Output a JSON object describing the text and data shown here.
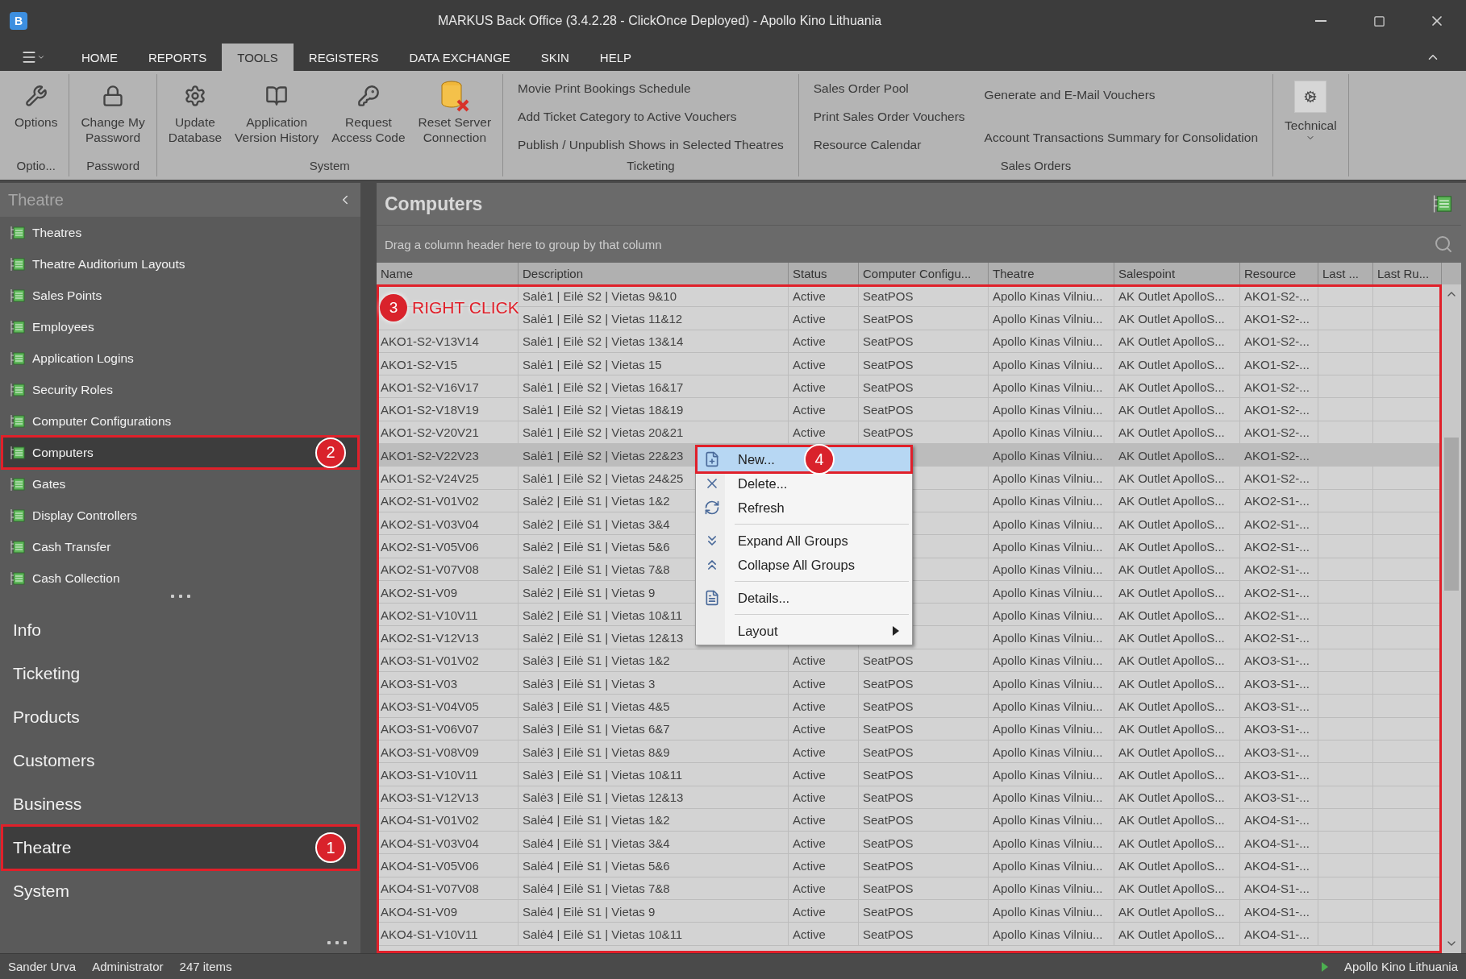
{
  "window": {
    "app_icon": "B",
    "title": "MARKUS Back Office (3.4.2.28 - ClickOnce Deployed)  - Apollo Kino Lithuania"
  },
  "ribbon": {
    "tabs": [
      {
        "label": "HOME",
        "selected": false
      },
      {
        "label": "REPORTS",
        "selected": false
      },
      {
        "label": "TOOLS",
        "selected": true
      },
      {
        "label": "REGISTERS",
        "selected": false
      },
      {
        "label": "DATA EXCHANGE",
        "selected": false
      },
      {
        "label": "SKIN",
        "selected": false
      },
      {
        "label": "HELP",
        "selected": false
      }
    ],
    "groups": [
      {
        "label": "Optio...",
        "kind": "large",
        "buttons": [
          "Options"
        ]
      },
      {
        "label": "Password",
        "kind": "large",
        "buttons": [
          "Change My\nPassword"
        ]
      },
      {
        "label": "System",
        "kind": "large",
        "buttons": [
          "Update\nDatabase",
          "Application\nVersion History",
          "Request\nAccess Code",
          "Reset Server\nConnection"
        ]
      },
      {
        "label": "Ticketing",
        "kind": "links",
        "columns": [
          [
            "Movie Print Bookings Schedule",
            "Add Ticket Category to Active Vouchers",
            "Publish / Unpublish Shows in Selected Theatres"
          ]
        ]
      },
      {
        "label": "Sales Orders",
        "kind": "links",
        "columns": [
          [
            "Sales Order Pool",
            "Print Sales Order Vouchers",
            "Resource Calendar"
          ],
          [
            "Generate and E-Mail Vouchers",
            "Account Transactions Summary for Consolidation"
          ]
        ]
      },
      {
        "kind": "dropdown",
        "buttons": [
          "Technical"
        ]
      }
    ]
  },
  "sidebar": {
    "header": "Theatre",
    "items": [
      {
        "label": "Theatres",
        "selected": false
      },
      {
        "label": "Theatre Auditorium Layouts",
        "selected": false
      },
      {
        "label": "Sales Points",
        "selected": false
      },
      {
        "label": "Employees",
        "selected": false
      },
      {
        "label": "Application Logins",
        "selected": false
      },
      {
        "label": "Security Roles",
        "selected": false
      },
      {
        "label": "Computer Configurations",
        "selected": false
      },
      {
        "label": "Computers",
        "selected": true,
        "annotation": "2"
      },
      {
        "label": "Gates",
        "selected": false
      },
      {
        "label": "Display Controllers",
        "selected": false
      },
      {
        "label": "Cash Transfer",
        "selected": false
      },
      {
        "label": "Cash Collection",
        "selected": false
      }
    ],
    "groups": [
      {
        "label": "Info",
        "selected": false
      },
      {
        "label": "Ticketing",
        "selected": false
      },
      {
        "label": "Products",
        "selected": false
      },
      {
        "label": "Customers",
        "selected": false
      },
      {
        "label": "Business",
        "selected": false
      },
      {
        "label": "Theatre",
        "selected": true,
        "annotation": "1"
      },
      {
        "label": "System",
        "selected": false
      }
    ]
  },
  "main": {
    "title": "Computers",
    "group_panel": "Drag a column header here to group by that column",
    "table": {
      "columns": [
        "Name",
        "Description",
        "Status",
        "Computer Configu...",
        "Theatre",
        "Salespoint",
        "Resource",
        "Last ...",
        "Last Ru..."
      ],
      "annotation": {
        "number": "3",
        "text": "RIGHT CLICK"
      },
      "rows": [
        {
          "description": "Salė1 | Eilė S2 | Vietas 9&10",
          "status": "Active",
          "configuration": "SeatPOS",
          "theatre": "Apollo Kinas Vilniu...",
          "salespoint": "AK Outlet ApolloS...",
          "resource": "AKO1-S2-...",
          "selected": false
        },
        {
          "description": "Salė1 | Eilė S2 | Vietas 11&12",
          "status": "Active",
          "configuration": "SeatPOS",
          "theatre": "Apollo Kinas Vilniu...",
          "salespoint": "AK Outlet ApolloS...",
          "resource": "AKO1-S2-...",
          "selected": false
        },
        {
          "name": "AKO1-S2-V13V14",
          "description": "Salė1 | Eilė S2 | Vietas 13&14",
          "status": "Active",
          "configuration": "SeatPOS",
          "theatre": "Apollo Kinas Vilniu...",
          "salespoint": "AK Outlet ApolloS...",
          "resource": "AKO1-S2-...",
          "selected": false
        },
        {
          "name": "AKO1-S2-V15",
          "description": "Salė1 | Eilė S2 | Vietas 15",
          "status": "Active",
          "configuration": "SeatPOS",
          "theatre": "Apollo Kinas Vilniu...",
          "salespoint": "AK Outlet ApolloS...",
          "resource": "AKO1-S2-...",
          "selected": false
        },
        {
          "name": "AKO1-S2-V16V17",
          "description": "Salė1 | Eilė S2 | Vietas 16&17",
          "status": "Active",
          "configuration": "SeatPOS",
          "theatre": "Apollo Kinas Vilniu...",
          "salespoint": "AK Outlet ApolloS...",
          "resource": "AKO1-S2-...",
          "selected": false
        },
        {
          "name": "AKO1-S2-V18V19",
          "description": "Salė1 | Eilė S2 | Vietas 18&19",
          "status": "Active",
          "configuration": "SeatPOS",
          "theatre": "Apollo Kinas Vilniu...",
          "salespoint": "AK Outlet ApolloS...",
          "resource": "AKO1-S2-...",
          "selected": false
        },
        {
          "name": "AKO1-S2-V20V21",
          "description": "Salė1 | Eilė S2 | Vietas 20&21",
          "status": "Active",
          "configuration": "SeatPOS",
          "theatre": "Apollo Kinas Vilniu...",
          "salespoint": "AK Outlet ApolloS...",
          "resource": "AKO1-S2-...",
          "selected": false
        },
        {
          "name": "AKO1-S2-V22V23",
          "description": "Salė1 | Eilė S2 | Vietas 22&23",
          "theatre": "Apollo Kinas Vilniu...",
          "salespoint": "AK Outlet ApolloS...",
          "resource": "AKO1-S2-...",
          "selected": true
        },
        {
          "name": "AKO1-S2-V24V25",
          "description": "Salė1 | Eilė S2 | Vietas 24&25",
          "theatre": "Apollo Kinas Vilniu...",
          "salespoint": "AK Outlet ApolloS...",
          "resource": "AKO1-S2-...",
          "selected": false
        },
        {
          "name": "AKO2-S1-V01V02",
          "description": "Salė2 | Eilė S1 | Vietas 1&2",
          "theatre": "Apollo Kinas Vilniu...",
          "salespoint": "AK Outlet ApolloS...",
          "resource": "AKO2-S1-...",
          "selected": false
        },
        {
          "name": "AKO2-S1-V03V04",
          "description": "Salė2 | Eilė S1 | Vietas 3&4",
          "theatre": "Apollo Kinas Vilniu...",
          "salespoint": "AK Outlet ApolloS...",
          "resource": "AKO2-S1-...",
          "selected": false
        },
        {
          "name": "AKO2-S1-V05V06",
          "description": "Salė2 | Eilė S1 | Vietas 5&6",
          "theatre": "Apollo Kinas Vilniu...",
          "salespoint": "AK Outlet ApolloS...",
          "resource": "AKO2-S1-...",
          "selected": false
        },
        {
          "name": "AKO2-S1-V07V08",
          "description": "Salė2 | Eilė S1 | Vietas 7&8",
          "theatre": "Apollo Kinas Vilniu...",
          "salespoint": "AK Outlet ApolloS...",
          "resource": "AKO2-S1-...",
          "selected": false
        },
        {
          "name": "AKO2-S1-V09",
          "description": "Salė2 | Eilė S1 | Vietas 9",
          "theatre": "Apollo Kinas Vilniu...",
          "salespoint": "AK Outlet ApolloS...",
          "resource": "AKO2-S1-...",
          "selected": false
        },
        {
          "name": "AKO2-S1-V10V11",
          "description": "Salė2 | Eilė S1 | Vietas 10&11",
          "theatre": "Apollo Kinas Vilniu...",
          "salespoint": "AK Outlet ApolloS...",
          "resource": "AKO2-S1-...",
          "selected": false
        },
        {
          "name": "AKO2-S1-V12V13",
          "description": "Salė2 | Eilė S1 | Vietas 12&13",
          "theatre": "Apollo Kinas Vilniu...",
          "salespoint": "AK Outlet ApolloS...",
          "resource": "AKO2-S1-...",
          "selected": false
        },
        {
          "name": "AKO3-S1-V01V02",
          "description": "Salė3 | Eilė S1 | Vietas 1&2",
          "status": "Active",
          "configuration": "SeatPOS",
          "theatre": "Apollo Kinas Vilniu...",
          "salespoint": "AK Outlet ApolloS...",
          "resource": "AKO3-S1-...",
          "selected": false
        },
        {
          "name": "AKO3-S1-V03",
          "description": "Salė3 | Eilė S1 | Vietas 3",
          "status": "Active",
          "configuration": "SeatPOS",
          "theatre": "Apollo Kinas Vilniu...",
          "salespoint": "AK Outlet ApolloS...",
          "resource": "AKO3-S1-...",
          "selected": false
        },
        {
          "name": "AKO3-S1-V04V05",
          "description": "Salė3 | Eilė S1 | Vietas 4&5",
          "status": "Active",
          "configuration": "SeatPOS",
          "theatre": "Apollo Kinas Vilniu...",
          "salespoint": "AK Outlet ApolloS...",
          "resource": "AKO3-S1-...",
          "selected": false
        },
        {
          "name": "AKO3-S1-V06V07",
          "description": "Salė3 | Eilė S1 | Vietas 6&7",
          "status": "Active",
          "configuration": "SeatPOS",
          "theatre": "Apollo Kinas Vilniu...",
          "salespoint": "AK Outlet ApolloS...",
          "resource": "AKO3-S1-...",
          "selected": false
        },
        {
          "name": "AKO3-S1-V08V09",
          "description": "Salė3 | Eilė S1 | Vietas 8&9",
          "status": "Active",
          "configuration": "SeatPOS",
          "theatre": "Apollo Kinas Vilniu...",
          "salespoint": "AK Outlet ApolloS...",
          "resource": "AKO3-S1-...",
          "selected": false
        },
        {
          "name": "AKO3-S1-V10V11",
          "description": "Salė3 | Eilė S1 | Vietas 10&11",
          "status": "Active",
          "configuration": "SeatPOS",
          "theatre": "Apollo Kinas Vilniu...",
          "salespoint": "AK Outlet ApolloS...",
          "resource": "AKO3-S1-...",
          "selected": false
        },
        {
          "name": "AKO3-S1-V12V13",
          "description": "Salė3 | Eilė S1 | Vietas 12&13",
          "status": "Active",
          "configuration": "SeatPOS",
          "theatre": "Apollo Kinas Vilniu...",
          "salespoint": "AK Outlet ApolloS...",
          "resource": "AKO3-S1-...",
          "selected": false
        },
        {
          "name": "AKO4-S1-V01V02",
          "description": "Salė4 | Eilė S1 | Vietas 1&2",
          "status": "Active",
          "configuration": "SeatPOS",
          "theatre": "Apollo Kinas Vilniu...",
          "salespoint": "AK Outlet ApolloS...",
          "resource": "AKO4-S1-...",
          "selected": false
        },
        {
          "name": "AKO4-S1-V03V04",
          "description": "Salė4 | Eilė S1 | Vietas 3&4",
          "status": "Active",
          "configuration": "SeatPOS",
          "theatre": "Apollo Kinas Vilniu...",
          "salespoint": "AK Outlet ApolloS...",
          "resource": "AKO4-S1-...",
          "selected": false
        },
        {
          "name": "AKO4-S1-V05V06",
          "description": "Salė4 | Eilė S1 | Vietas 5&6",
          "status": "Active",
          "configuration": "SeatPOS",
          "theatre": "Apollo Kinas Vilniu...",
          "salespoint": "AK Outlet ApolloS...",
          "resource": "AKO4-S1-...",
          "selected": false
        },
        {
          "name": "AKO4-S1-V07V08",
          "description": "Salė4 | Eilė S1 | Vietas 7&8",
          "status": "Active",
          "configuration": "SeatPOS",
          "theatre": "Apollo Kinas Vilniu...",
          "salespoint": "AK Outlet ApolloS...",
          "resource": "AKO4-S1-...",
          "selected": false
        },
        {
          "name": "AKO4-S1-V09",
          "description": "Salė4 | Eilė S1 | Vietas 9",
          "status": "Active",
          "configuration": "SeatPOS",
          "theatre": "Apollo Kinas Vilniu...",
          "salespoint": "AK Outlet ApolloS...",
          "resource": "AKO4-S1-...",
          "selected": false
        },
        {
          "name": "AKO4-S1-V10V11",
          "description": "Salė4 | Eilė S1 | Vietas 10&11",
          "status": "Active",
          "configuration": "SeatPOS",
          "theatre": "Apollo Kinas Vilniu...",
          "salespoint": "AK Outlet ApolloS...",
          "resource": "AKO4-S1-...",
          "selected": false
        }
      ]
    },
    "context_menu": {
      "items": [
        {
          "label": "New...",
          "selected": true,
          "annotation": "4"
        },
        {
          "label": "Delete...",
          "selected": false
        },
        {
          "label": "Refresh",
          "selected": false
        },
        {
          "label": "Expand All Groups",
          "selected": false,
          "separator_before": true
        },
        {
          "label": "Collapse All Groups",
          "selected": false
        },
        {
          "label": "Details...",
          "selected": false,
          "separator_before": true
        },
        {
          "label": "Layout",
          "selected": false,
          "separator_before": true,
          "submenu": true
        }
      ]
    }
  },
  "status_bar": {
    "left": [
      "Sander Urva",
      "Administrator",
      "247 items"
    ],
    "right": "Apollo Kino Lithuania"
  }
}
